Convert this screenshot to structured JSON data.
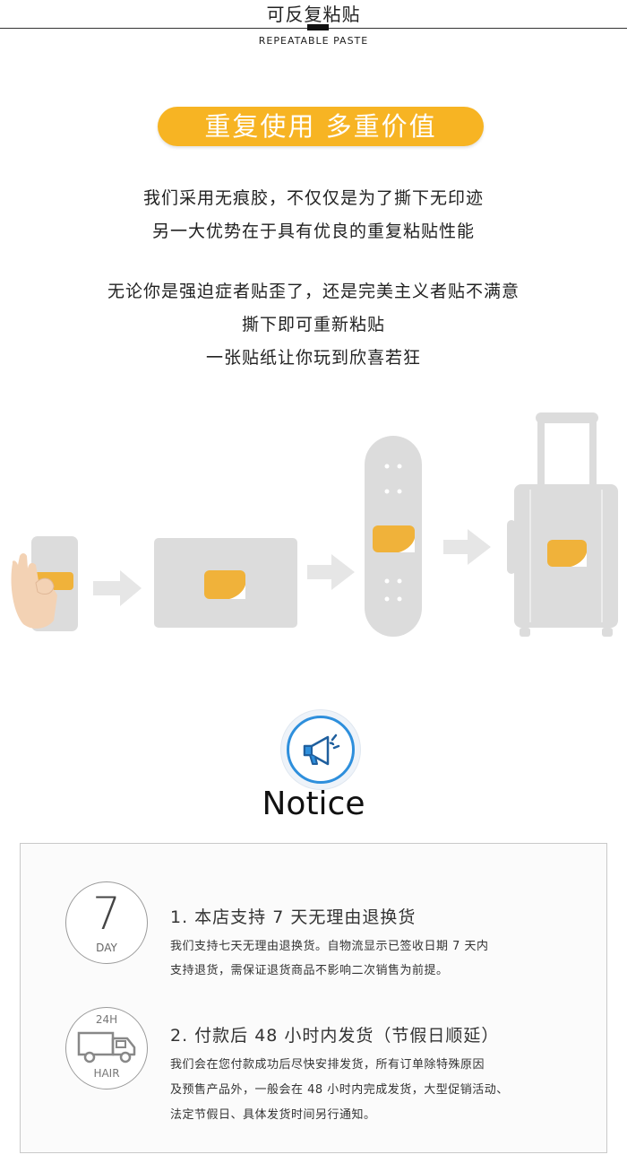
{
  "header": {
    "title": "可反复粘贴",
    "subtitle": "REPEATABLE PASTE"
  },
  "banner": {
    "label": "重复使用 多重价值"
  },
  "intro": {
    "lines": [
      "我们采用无痕胶，不仅仅是为了撕下无印迹",
      "另一大优势在于具有优良的重复粘贴性能",
      "无论你是强迫症者贴歪了，还是完美主义者贴不满意",
      "撕下即可重新粘贴",
      "一张贴纸让你玩到欣喜若狂"
    ]
  },
  "notice": {
    "title": "Notice",
    "items": [
      {
        "badge_main": "7",
        "badge_sub": "DAY",
        "title": "1. 本店支持 7 天无理由退换货",
        "desc": [
          "我们支持七天无理由退换货。自物流显示已签收日期 7 天内",
          "支持退货，需保证退货商品不影响二次销售为前提。"
        ]
      },
      {
        "badge_main": "24H",
        "badge_sub": "HAIR",
        "title": "2. 付款后 48 小时内发货（节假日顺延）",
        "desc": [
          "我们会在您付款成功后尽快安排发货，所有订单除特殊原因",
          "及预售产品外，一般会在 48 小时内完成发货，大型促销活动、",
          "法定节假日、具体发货时间另行通知。"
        ]
      }
    ]
  },
  "colors": {
    "accent": "#f7b423",
    "notice_blue": "#2e8fdc",
    "illustration_gray": "#dcdcdc"
  }
}
